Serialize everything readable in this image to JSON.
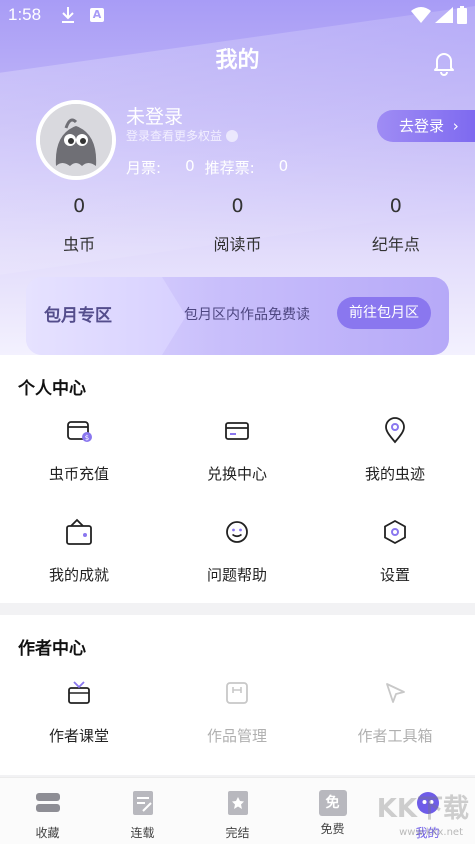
{
  "status_bar": {
    "time": "1:58",
    "a_badge": "A"
  },
  "header": {
    "title": "我的"
  },
  "profile": {
    "username": "未登录",
    "hint": "登录查看更多权益",
    "monthly_label": "月票:",
    "monthly_value": "0",
    "recommend_label": "推荐票:",
    "recommend_value": "0",
    "login_label": "去登录",
    "login_chevron": "›"
  },
  "stats": [
    {
      "value": "0",
      "label": "虫币"
    },
    {
      "value": "0",
      "label": "阅读币"
    },
    {
      "value": "0",
      "label": "纪年点"
    }
  ],
  "vip": {
    "title": "包月专区",
    "desc": "包月区内作品免费读",
    "button": "前往包月区"
  },
  "personal_center": {
    "title": "个人中心",
    "items": [
      {
        "label": "虫币充值",
        "icon": "wallet-coin-icon"
      },
      {
        "label": "兑换中心",
        "icon": "card-icon"
      },
      {
        "label": "我的虫迹",
        "icon": "location-pin-icon"
      },
      {
        "label": "我的成就",
        "icon": "gift-wallet-icon"
      },
      {
        "label": "问题帮助",
        "icon": "smile-icon"
      },
      {
        "label": "设置",
        "icon": "hexagon-settings-icon"
      }
    ]
  },
  "author_center": {
    "title": "作者中心",
    "items": [
      {
        "label": "作者课堂",
        "icon": "tv-icon"
      },
      {
        "label": "作品管理",
        "icon": "book-manage-icon"
      },
      {
        "label": "作者工具箱",
        "icon": "cursor-icon"
      }
    ]
  },
  "bottom_nav": [
    {
      "label": "收藏",
      "icon": "bookshelf-icon"
    },
    {
      "label": "连载",
      "icon": "serial-icon"
    },
    {
      "label": "完结",
      "icon": "finished-icon"
    },
    {
      "label": "免费",
      "icon": "free-icon",
      "badge": "免"
    },
    {
      "label": "我的",
      "icon": "profile-icon"
    }
  ],
  "watermark": {
    "text": "KK下载",
    "sub": "www.kkx.net"
  },
  "colors": {
    "accent": "#7e6af0",
    "header_top": "#a89cf6"
  }
}
